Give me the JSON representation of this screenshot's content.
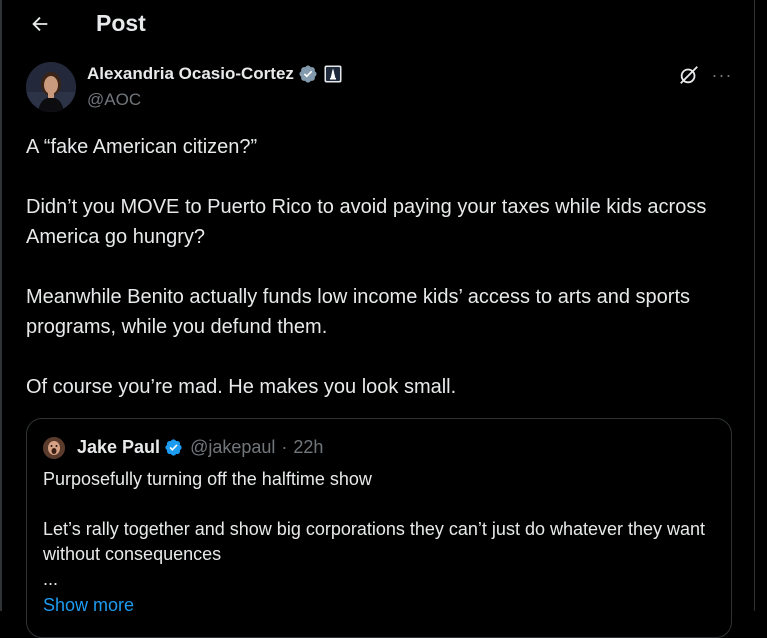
{
  "header": {
    "back_icon": "arrow-left-icon",
    "title": "Post"
  },
  "author": {
    "display_name": "Alexandria Ocasio-Cortez",
    "handle": "@AOC",
    "verified_icon": "verified-badge-icon",
    "verified_color": "#1d9bf0",
    "affiliation_icon": "government-building-icon"
  },
  "actions": {
    "grok_icon": "grok-icon",
    "more_label": "···"
  },
  "post": {
    "paragraphs": [
      "A “fake American citizen?”",
      "Didn’t you MOVE to Puerto Rico to avoid paying your taxes while kids across America go hungry?",
      "Meanwhile Benito actually funds low income kids’ access to arts and sports programs, while you defund them.",
      "Of course you’re mad. He makes you look small."
    ]
  },
  "quoted_post": {
    "display_name": "Jake Paul",
    "handle": "@jakepaul",
    "separator": "·",
    "time": "22h",
    "verified_icon": "verified-badge-icon",
    "paragraphs": [
      "Purposefully turning off the halftime show",
      "Let’s rally together and show big corporations they can’t just do whatever they want without consequences",
      "..."
    ],
    "show_more": "Show more"
  },
  "colors": {
    "background": "#000000",
    "text": "#e7e9ea",
    "secondary_text": "#71767b",
    "accent": "#1d9bf0",
    "border": "#2f3336"
  }
}
